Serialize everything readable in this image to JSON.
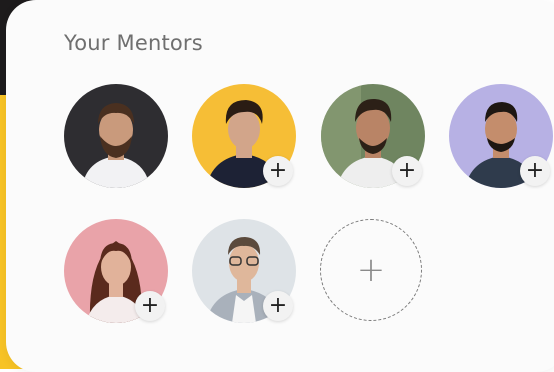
{
  "title": "Your Mentors",
  "colors": {
    "accent_yellow": "#f7c325",
    "dark": "#1d1b1c",
    "card_bg": "#fbfbfb"
  },
  "mentors": [
    {
      "bg": "#2e2d31",
      "shirt": "#f2f2f4",
      "hair": "#4a3020",
      "skin": "#c99a7c",
      "has_add": false
    },
    {
      "bg": "#f6be36",
      "shirt": "#1d2235",
      "hair": "#2a1c14",
      "skin": "#d2a58a",
      "has_add": true
    },
    {
      "bg": "#6f8560",
      "shirt": "#eeeeee",
      "hair": "#2c2017",
      "skin": "#b98466",
      "has_add": true
    },
    {
      "bg": "#b7b1e4",
      "shirt": "#2f3b4c",
      "hair": "#1e1712",
      "skin": "#c48d6c",
      "has_add": true
    },
    {
      "bg": "#e9a3a9",
      "shirt": "#f4ecec",
      "hair": "#5a2a1d",
      "skin": "#e1b29a",
      "has_add": true
    },
    {
      "bg": "#dee3e7",
      "shirt": "#a9b1bb",
      "hair": "#5b4a3c",
      "skin": "#dfb79b",
      "has_add": true
    }
  ],
  "add_badge_symbol": "+",
  "add_slot_symbol": "+"
}
